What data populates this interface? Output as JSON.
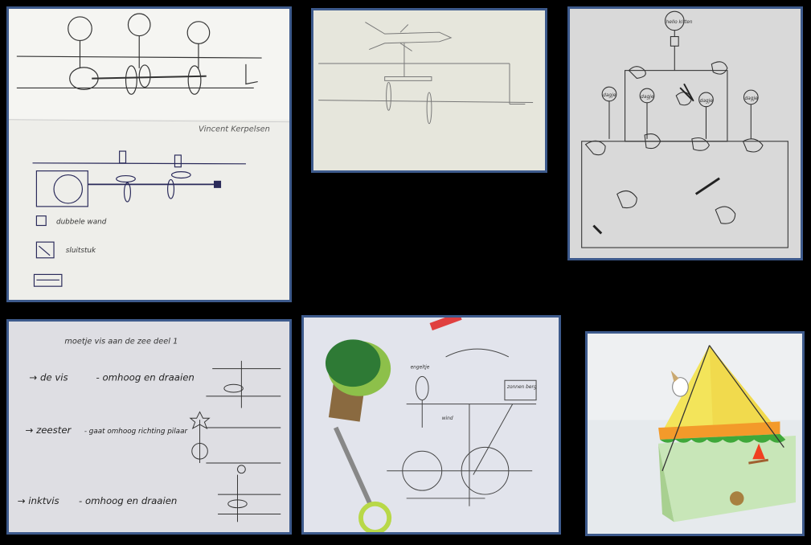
{
  "collage": {
    "background": "#000000",
    "frame_color": "#3d5a8c",
    "photos": [
      {
        "id": "sketch-mechanism-1",
        "caption": "Vincent Kerpelsen",
        "legend": [
          {
            "label": "dubbele wand"
          },
          {
            "label": "sluitstuk"
          },
          {
            "label": ""
          }
        ]
      },
      {
        "id": "sketch-airplane"
      },
      {
        "id": "sketch-box-lollipops",
        "top_label": "hello kitten",
        "lollipop_labels": [
          "dagje",
          "dagje",
          "dagje",
          "dagje"
        ]
      },
      {
        "id": "notes-moetje-vis",
        "heading": "moetje vis aan de zee   deel 1",
        "items": [
          {
            "subject": "de vis",
            "action": "omhoog en draaien"
          },
          {
            "subject": "zeester",
            "action": "gaat omhoog richting pilaar"
          },
          {
            "subject": "inktvis",
            "action": "omhoog en draaien"
          }
        ]
      },
      {
        "id": "sketch-gears-tree-scissors",
        "labels": [
          "engeltje",
          "wind",
          "zonnen berg"
        ]
      },
      {
        "id": "photo-pyramid-tent-box"
      }
    ]
  }
}
